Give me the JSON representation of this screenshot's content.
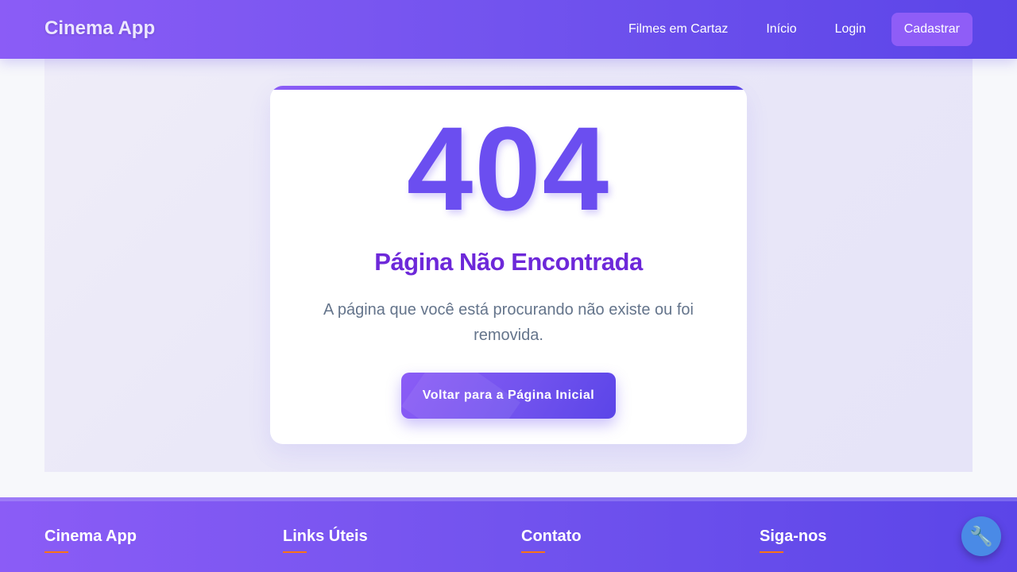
{
  "header": {
    "brand": "Cinema App",
    "nav": [
      {
        "label": "Filmes em Cartaz"
      },
      {
        "label": "Início"
      },
      {
        "label": "Login"
      },
      {
        "label": "Cadastrar"
      }
    ]
  },
  "error": {
    "code": "404",
    "title": "Página Não Encontrada",
    "message": "A página que você está procurando não existe ou foi removida.",
    "button": "Voltar para a Página Inicial"
  },
  "footer": {
    "columns": [
      {
        "title": "Cinema App"
      },
      {
        "title": "Links Úteis"
      },
      {
        "title": "Contato"
      },
      {
        "title": "Siga-nos"
      }
    ]
  },
  "fab": {
    "icon": "wrench-icon",
    "glyph": "🔧"
  },
  "colors": {
    "primary": "#6b4ef0",
    "title": "#6d28d9",
    "accent": "#f97316",
    "fab": "#4a8ae6"
  }
}
